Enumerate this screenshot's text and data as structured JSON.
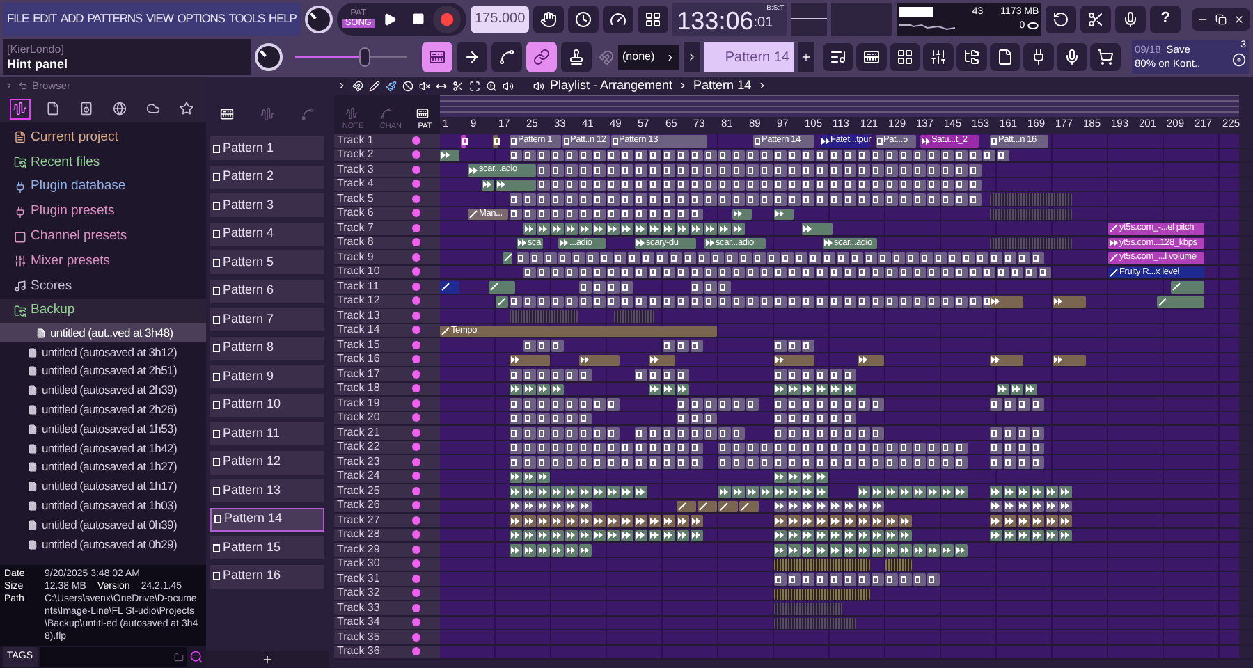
{
  "menu": [
    "FILE",
    "EDIT",
    "ADD",
    "PATTERNS",
    "VIEW",
    "OPTIONS",
    "TOOLS",
    "HELP"
  ],
  "transport": {
    "modes": [
      {
        "label": "PAT",
        "selected": false
      },
      {
        "label": "SONG",
        "selected": true
      }
    ],
    "tempo": "175.000"
  },
  "time": {
    "value": "133:06",
    "sub": ":01",
    "unit": "B:S:T"
  },
  "monitor": {
    "polyphony": "43",
    "memory": "1173 MB",
    "cpu": "0"
  },
  "help": "?",
  "hint": {
    "title": "[KierLondo]",
    "text": "Hint panel"
  },
  "master_pitch": {
    "level": 0.62
  },
  "tools": [
    {
      "kind": "piano",
      "on": true
    },
    {
      "kind": "arrow",
      "on": false
    },
    {
      "kind": "curve",
      "on": false
    },
    {
      "kind": "link",
      "on": true
    },
    {
      "kind": "stamp",
      "on": false
    }
  ],
  "snap": "(none)",
  "pattern_selector": "Pattern 14",
  "news": {
    "date": "09/18",
    "line1": "Save",
    "line2": "80% on Kont..",
    "badge": "3"
  },
  "browser": {
    "title": "Browser",
    "tabs": [
      {
        "kind": "all",
        "selected": true
      },
      {
        "kind": "file",
        "selected": false
      },
      {
        "kind": "speaker",
        "selected": false
      },
      {
        "kind": "globe",
        "selected": false
      },
      {
        "kind": "cloud",
        "selected": false
      },
      {
        "kind": "star",
        "selected": false
      }
    ],
    "folders": [
      {
        "label": "Current project",
        "kind": "project",
        "color": "#d8a888",
        "expanded": false
      },
      {
        "label": "Recent files",
        "kind": "recent",
        "color": "#8fd08f",
        "expanded": false
      },
      {
        "label": "Plugin database",
        "kind": "plugin",
        "color": "#8fb0e8",
        "expanded": false
      },
      {
        "label": "Plugin presets",
        "kind": "plugin",
        "color": "#d890c0",
        "expanded": false
      },
      {
        "label": "Channel presets",
        "kind": "channel",
        "color": "#d890c0",
        "expanded": false
      },
      {
        "label": "Mixer presets",
        "kind": "mixer",
        "color": "#d890c0",
        "expanded": false
      },
      {
        "label": "Scores",
        "kind": "score",
        "color": "#c8c0d8",
        "expanded": false
      },
      {
        "label": "Backup",
        "kind": "recent",
        "color": "#8fd08f",
        "expanded": true,
        "children": [
          {
            "label": "untitled (aut..ved at 3h48)",
            "selected": true
          },
          {
            "label": "untitled (autosaved at 3h12)",
            "selected": false
          },
          {
            "label": "untitled (autosaved at 2h51)",
            "selected": false
          },
          {
            "label": "untitled (autosaved at 2h39)",
            "selected": false
          },
          {
            "label": "untitled (autosaved at 2h26)",
            "selected": false
          },
          {
            "label": "untitled (autosaved at 1h53)",
            "selected": false
          },
          {
            "label": "untitled (autosaved at 1h42)",
            "selected": false
          },
          {
            "label": "untitled (autosaved at 1h27)",
            "selected": false
          },
          {
            "label": "untitled (autosaved at 1h17)",
            "selected": false
          },
          {
            "label": "untitled (autosaved at 1h03)",
            "selected": false
          },
          {
            "label": "untitled (autosaved at 0h39)",
            "selected": false
          },
          {
            "label": "untitled (autosaved at 0h29)",
            "selected": false
          }
        ]
      }
    ],
    "info": {
      "date_label": "Date",
      "date": "9/20/2025 3:48:02 AM",
      "size_label": "Size",
      "size": "12.38 MB",
      "version_label": "Version",
      "version": "24.2.1.45",
      "path_label": "Path",
      "path": "C:\\Users\\svenx\\OneDrive\\D-ocuments\\Image-Line\\FL St-udio\\Projects\\Backup\\untitl-ed (autosaved at 3h48).flp"
    },
    "tags": "TAGS"
  },
  "patterns": [
    {
      "label": "Pattern 1",
      "selected": false
    },
    {
      "label": "Pattern 2",
      "selected": false
    },
    {
      "label": "Pattern 3",
      "selected": false
    },
    {
      "label": "Pattern 4",
      "selected": false
    },
    {
      "label": "Pattern 5",
      "selected": false
    },
    {
      "label": "Pattern 6",
      "selected": false
    },
    {
      "label": "Pattern 7",
      "selected": false
    },
    {
      "label": "Pattern 8",
      "selected": false
    },
    {
      "label": "Pattern 9",
      "selected": false
    },
    {
      "label": "Pattern 10",
      "selected": false
    },
    {
      "label": "Pattern 11",
      "selected": false
    },
    {
      "label": "Pattern 12",
      "selected": false
    },
    {
      "label": "Pattern 13",
      "selected": false
    },
    {
      "label": "Pattern 14",
      "selected": true
    },
    {
      "label": "Pattern 15",
      "selected": false
    },
    {
      "label": "Pattern 16",
      "selected": false
    }
  ],
  "playlist": {
    "title": "Playlist - Arrangement",
    "pattern": "Pattern 14",
    "modes": [
      {
        "label": "NOTE",
        "selected": false
      },
      {
        "label": "CHAN",
        "selected": false
      },
      {
        "label": "PAT",
        "selected": true
      }
    ],
    "ruler": [
      "1",
      "9",
      "17",
      "25",
      "33",
      "41",
      "49",
      "57",
      "65",
      "73",
      "81",
      "89",
      "97",
      "105",
      "113",
      "121",
      "129",
      "137",
      "145",
      "153",
      "161",
      "169",
      "177",
      "185",
      "193",
      "201",
      "209",
      "217",
      "225"
    ],
    "tracks": [
      {
        "name": "Track 1",
        "clips": [
          {
            "kind": "pattern",
            "color": "#c040c0"
          },
          {
            "kind": "pattern",
            "color": "#7a6a50"
          },
          {
            "kind": "pattern",
            "color": "#6c6180",
            "label": "Pattern 1"
          },
          {
            "kind": "pattern",
            "color": "#6c6180",
            "label": "Patt..n 12"
          },
          {
            "kind": "pattern",
            "color": "#6c6180",
            "label": "Pattern 13"
          },
          {
            "kind": "pattern",
            "color": "#6c6180",
            "label": "Pattern 14"
          },
          {
            "kind": "audio",
            "color": "#2a1e88",
            "label": "Fatet...tpur"
          },
          {
            "kind": "pattern",
            "color": "#6c6180",
            "label": "Pat...5"
          },
          {
            "kind": "audio",
            "color": "#9a2aa8",
            "label": "Satu...t_2"
          },
          {
            "kind": "pattern",
            "color": "#6c6180",
            "label": "Patt...n 16"
          }
        ]
      },
      {
        "name": "Track 2",
        "clips": [
          {
            "kind": "audio",
            "color": "#5e7d6a"
          },
          {
            "kind": "pattern",
            "color": "#6c6180"
          }
        ]
      },
      {
        "name": "Track 3",
        "clips": [
          {
            "kind": "audio",
            "color": "#5e7d6a",
            "label": "scar...adio"
          },
          {
            "kind": "pattern",
            "color": "#6c6180"
          }
        ]
      },
      {
        "name": "Track 4",
        "clips": [
          {
            "kind": "audio",
            "color": "#5e7d6a"
          },
          {
            "kind": "audio",
            "color": "#5e7d6a"
          },
          {
            "kind": "pattern",
            "color": "#6c6180"
          }
        ]
      },
      {
        "name": "Track 5",
        "clips": [
          {
            "kind": "pattern",
            "color": "#6c6180"
          },
          {
            "kind": "slices",
            "color": "#5a4a6a"
          }
        ]
      },
      {
        "name": "Track 6",
        "clips": [
          {
            "kind": "automation",
            "color": "#7a6a70",
            "label": "Man..."
          },
          {
            "kind": "pattern",
            "color": "#6c6180"
          },
          {
            "kind": "audio",
            "color": "#5e7d6a"
          },
          {
            "kind": "audio",
            "color": "#5e7d6a"
          },
          {
            "kind": "slices",
            "color": "#5a4a6a"
          }
        ]
      },
      {
        "name": "Track 7",
        "clips": [
          {
            "kind": "audio",
            "color": "#5e7d6a"
          },
          {
            "kind": "audio",
            "color": "#5e7d6a"
          },
          {
            "kind": "automation",
            "color": "#b040b8",
            "label": "yt5s.com_-...el pitch"
          }
        ]
      },
      {
        "name": "Track 8",
        "clips": [
          {
            "kind": "audio",
            "color": "#5e7d6a",
            "label": "sca"
          },
          {
            "kind": "audio",
            "color": "#5e7d6a",
            "label": "...adio"
          },
          {
            "kind": "audio",
            "color": "#5e7d6a",
            "label": "scary-du"
          },
          {
            "kind": "audio",
            "color": "#5e7d6a",
            "label": "scar...adio"
          },
          {
            "kind": "audio",
            "color": "#5e7d6a",
            "label": "scar...adio"
          },
          {
            "kind": "slices",
            "color": "#5a4a6a"
          },
          {
            "kind": "audio",
            "color": "#b040b8",
            "label": "yt5s.com...128_kbps"
          }
        ]
      },
      {
        "name": "Track 9",
        "clips": [
          {
            "kind": "automation",
            "color": "#5e7d6a"
          },
          {
            "kind": "pattern",
            "color": "#6c6180"
          },
          {
            "kind": "automation",
            "color": "#b040b8",
            "label": "yt5s.com_...l volume"
          }
        ]
      },
      {
        "name": "Track 10",
        "clips": [
          {
            "kind": "pattern",
            "color": "#6c6180"
          },
          {
            "kind": "automation",
            "color": "#1e2a90",
            "label": "Fruity R...x level"
          }
        ]
      },
      {
        "name": "Track 11",
        "clips": [
          {
            "kind": "automation",
            "color": "#1e2a90"
          },
          {
            "kind": "automation",
            "color": "#5e7d6a"
          },
          {
            "kind": "pattern",
            "color": "#6c6180"
          },
          {
            "kind": "pattern",
            "color": "#6c6180"
          },
          {
            "kind": "automation",
            "color": "#5e7d6a"
          }
        ]
      },
      {
        "name": "Track 12",
        "clips": [
          {
            "kind": "automation",
            "color": "#5e7d6a"
          },
          {
            "kind": "pattern",
            "color": "#6c6180"
          },
          {
            "kind": "audio",
            "color": "#7a6650"
          },
          {
            "kind": "audio",
            "color": "#7a6650"
          },
          {
            "kind": "automation",
            "color": "#5e7d6a"
          }
        ]
      },
      {
        "name": "Track 13",
        "clips": [
          {
            "kind": "slices",
            "color": "#5a4a6a"
          },
          {
            "kind": "slices",
            "color": "#5a4a6a"
          }
        ]
      },
      {
        "name": "Track 14",
        "clips": [
          {
            "kind": "automation",
            "color": "#7a6650",
            "label": "Tempo"
          }
        ]
      },
      {
        "name": "Track 15",
        "clips": [
          {
            "kind": "pattern",
            "color": "#6c6180"
          },
          {
            "kind": "pattern",
            "color": "#6c6180"
          },
          {
            "kind": "pattern",
            "color": "#6c6180"
          }
        ]
      },
      {
        "name": "Track 16",
        "clips": [
          {
            "kind": "audio",
            "color": "#7a6650"
          },
          {
            "kind": "audio",
            "color": "#7a6650"
          },
          {
            "kind": "audio",
            "color": "#7a6650"
          },
          {
            "kind": "audio",
            "color": "#7a6650"
          },
          {
            "kind": "audio",
            "color": "#7a6650"
          },
          {
            "kind": "audio",
            "color": "#7a6650"
          },
          {
            "kind": "audio",
            "color": "#7a6650"
          }
        ]
      },
      {
        "name": "Track 17",
        "clips": [
          {
            "kind": "pattern",
            "color": "#6c6180"
          },
          {
            "kind": "pattern",
            "color": "#6c6180"
          },
          {
            "kind": "pattern",
            "color": "#6c6180"
          }
        ]
      },
      {
        "name": "Track 18",
        "clips": [
          {
            "kind": "audio",
            "color": "#5e7d6a"
          },
          {
            "kind": "audio",
            "color": "#5e7d6a"
          },
          {
            "kind": "audio",
            "color": "#5e7d6a"
          },
          {
            "kind": "audio",
            "color": "#5e7d6a"
          }
        ]
      },
      {
        "name": "Track 19",
        "clips": [
          {
            "kind": "pattern",
            "color": "#6c6180"
          },
          {
            "kind": "pattern",
            "color": "#6c6180"
          },
          {
            "kind": "pattern",
            "color": "#6c6180"
          },
          {
            "kind": "pattern",
            "color": "#6c6180"
          }
        ]
      },
      {
        "name": "Track 20",
        "clips": [
          {
            "kind": "pattern",
            "color": "#6c6180"
          },
          {
            "kind": "pattern",
            "color": "#6c6180"
          },
          {
            "kind": "pattern",
            "color": "#6c6180"
          }
        ]
      },
      {
        "name": "Track 21",
        "clips": [
          {
            "kind": "pattern",
            "color": "#6c6180"
          },
          {
            "kind": "pattern",
            "color": "#6c6180"
          },
          {
            "kind": "pattern",
            "color": "#6c6180"
          },
          {
            "kind": "pattern",
            "color": "#6c6180"
          }
        ]
      },
      {
        "name": "Track 22",
        "clips": [
          {
            "kind": "pattern",
            "color": "#6c6180"
          },
          {
            "kind": "pattern",
            "color": "#6c6180"
          },
          {
            "kind": "pattern",
            "color": "#6c6180"
          }
        ]
      },
      {
        "name": "Track 23",
        "clips": [
          {
            "kind": "pattern",
            "color": "#6c6180"
          },
          {
            "kind": "pattern",
            "color": "#6c6180"
          },
          {
            "kind": "pattern",
            "color": "#6c6180"
          }
        ]
      },
      {
        "name": "Track 24",
        "clips": [
          {
            "kind": "audio",
            "color": "#5e7d6a"
          },
          {
            "kind": "audio",
            "color": "#5e7d6a"
          }
        ]
      },
      {
        "name": "Track 25",
        "clips": [
          {
            "kind": "audio",
            "color": "#5e7d6a"
          },
          {
            "kind": "audio",
            "color": "#5e7d6a"
          },
          {
            "kind": "audio",
            "color": "#5e7d6a"
          },
          {
            "kind": "audio",
            "color": "#5e7d6a"
          }
        ]
      },
      {
        "name": "Track 26",
        "clips": [
          {
            "kind": "audio",
            "color": "#6c6180"
          },
          {
            "kind": "automation",
            "color": "#7a6650"
          },
          {
            "kind": "audio",
            "color": "#6c6180"
          },
          {
            "kind": "audio",
            "color": "#6c6180"
          }
        ]
      },
      {
        "name": "Track 27",
        "clips": [
          {
            "kind": "audio",
            "color": "#7a6650"
          },
          {
            "kind": "audio",
            "color": "#7a6650"
          },
          {
            "kind": "audio",
            "color": "#7a6650"
          }
        ]
      },
      {
        "name": "Track 28",
        "clips": [
          {
            "kind": "audio",
            "color": "#5e7d6a"
          },
          {
            "kind": "audio",
            "color": "#5e7d6a"
          },
          {
            "kind": "audio",
            "color": "#5e7d6a"
          }
        ]
      },
      {
        "name": "Track 29",
        "clips": [
          {
            "kind": "audio",
            "color": "#5e7d6a"
          },
          {
            "kind": "audio",
            "color": "#5e7d6a"
          }
        ]
      },
      {
        "name": "Track 30",
        "clips": [
          {
            "kind": "slices",
            "color": "#8a7a3a"
          },
          {
            "kind": "slices",
            "color": "#8a7a3a"
          }
        ]
      },
      {
        "name": "Track 31",
        "clips": [
          {
            "kind": "pattern",
            "color": "#6c6180"
          }
        ]
      },
      {
        "name": "Track 32",
        "clips": [
          {
            "kind": "slices",
            "color": "#8a7a3a"
          }
        ]
      },
      {
        "name": "Track 33",
        "clips": [
          {
            "kind": "slices",
            "color": "#5a4a6a"
          }
        ]
      },
      {
        "name": "Track 34",
        "clips": [
          {
            "kind": "slices",
            "color": "#5a4a6a"
          }
        ]
      },
      {
        "name": "Track 35"
      },
      {
        "name": "Track 36"
      }
    ]
  }
}
